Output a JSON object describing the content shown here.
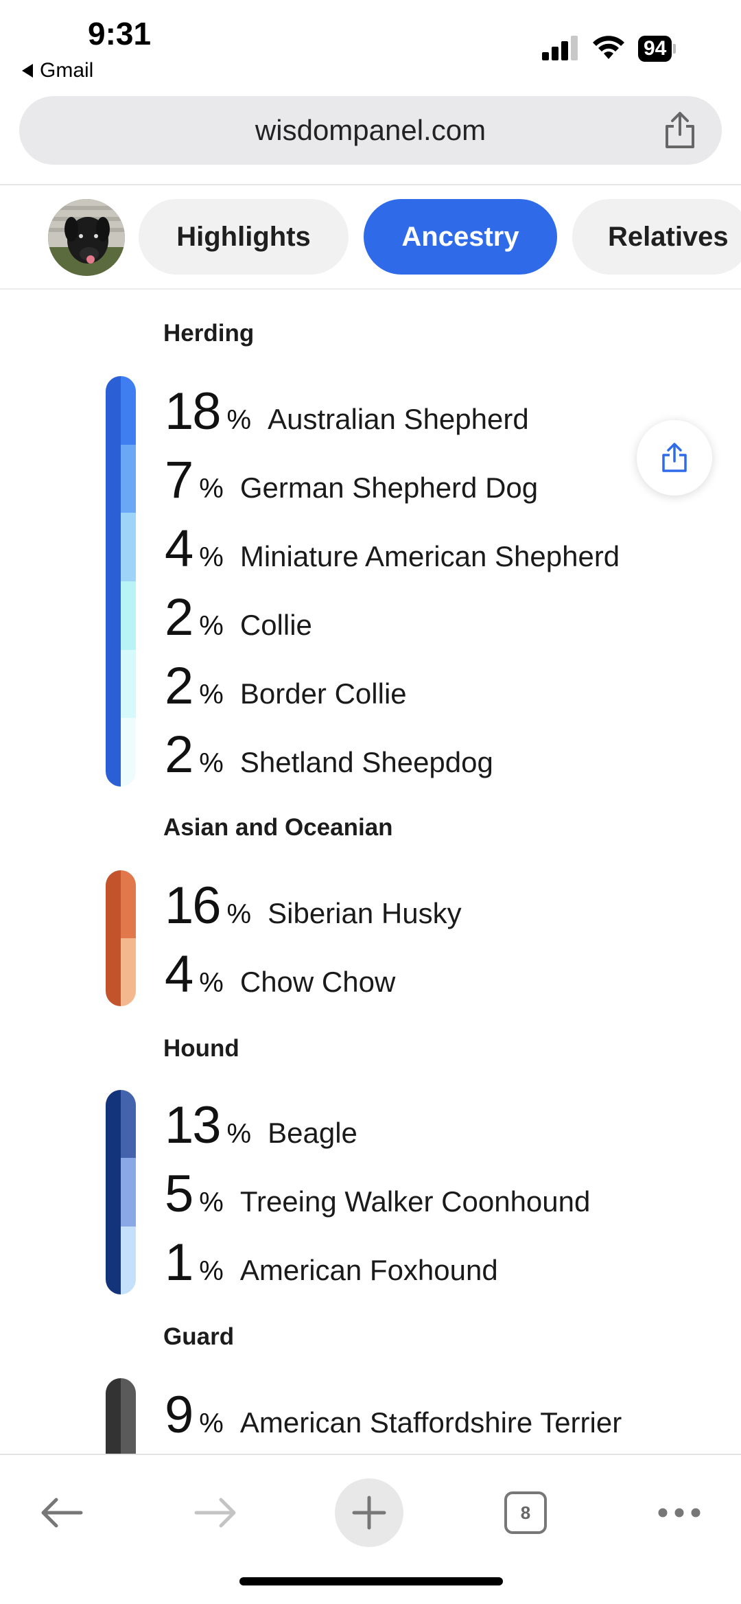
{
  "status_bar": {
    "time": "9:31",
    "back_app": "Gmail",
    "battery": "94"
  },
  "browser": {
    "url": "wisdompanel.com",
    "tabs_count": "8"
  },
  "tabs": [
    {
      "label": "Highlights",
      "active": false
    },
    {
      "label": "Ancestry",
      "active": true
    },
    {
      "label": "Relatives",
      "active": false
    }
  ],
  "groups": [
    {
      "title": "Herding",
      "edge_color": "#2a5fd6",
      "breeds": [
        {
          "pct": "18",
          "name": "Australian Shepherd",
          "color": "#3f7ef0"
        },
        {
          "pct": "7",
          "name": "German Shepherd Dog",
          "color": "#6aa8f5"
        },
        {
          "pct": "4",
          "name": "Miniature American Shepherd",
          "color": "#9ed4f8"
        },
        {
          "pct": "2",
          "name": "Collie",
          "color": "#b8f3f6"
        },
        {
          "pct": "2",
          "name": "Border Collie",
          "color": "#d6fafb"
        },
        {
          "pct": "2",
          "name": "Shetland Sheepdog",
          "color": "#eefcfe"
        }
      ]
    },
    {
      "title": "Asian and Oceanian",
      "edge_color": "#c2532b",
      "breeds": [
        {
          "pct": "16",
          "name": "Siberian Husky",
          "color": "#e0784c"
        },
        {
          "pct": "4",
          "name": "Chow Chow",
          "color": "#f3b88e"
        }
      ]
    },
    {
      "title": "Hound",
      "edge_color": "#13337a",
      "breeds": [
        {
          "pct": "13",
          "name": "Beagle",
          "color": "#4364ad"
        },
        {
          "pct": "5",
          "name": "Treeing Walker Coonhound",
          "color": "#8aa7e6"
        },
        {
          "pct": "1",
          "name": "American Foxhound",
          "color": "#c5e0fb"
        }
      ]
    },
    {
      "title": "Guard",
      "edge_color": "#333333",
      "breeds": [
        {
          "pct": "9",
          "name": "American Staffordshire Terrier",
          "color": "#5a5a5a"
        }
      ]
    }
  ],
  "icons": {
    "share": "share-icon",
    "back": "arrow-left-icon",
    "forward": "arrow-right-icon",
    "new_tab": "plus-icon",
    "tabs": "tabs-icon",
    "more": "more-icon"
  }
}
